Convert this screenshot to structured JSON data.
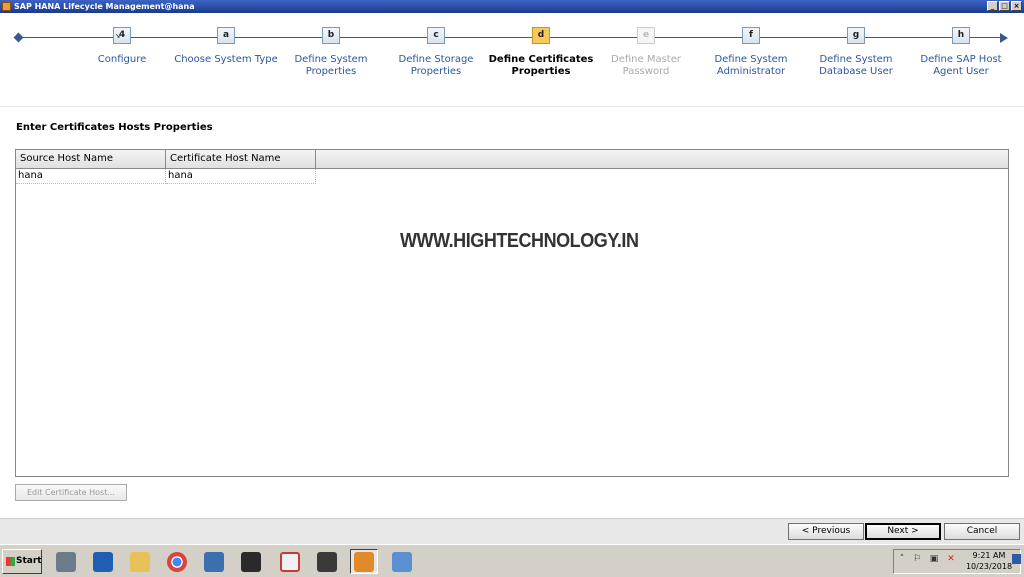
{
  "window": {
    "title": "SAP HANA Lifecycle Management@hana",
    "minimize": "_",
    "maximize": "□",
    "close": "×"
  },
  "roadmap": {
    "steps": [
      {
        "key": "4",
        "sub": "↘",
        "label_line1": "Configure",
        "label_line2": "",
        "state": "normal"
      },
      {
        "key": "a",
        "sub": "",
        "label_line1": "Choose System Type",
        "label_line2": "",
        "state": "normal"
      },
      {
        "key": "b",
        "sub": "",
        "label_line1": "Define System",
        "label_line2": "Properties",
        "state": "normal"
      },
      {
        "key": "c",
        "sub": "",
        "label_line1": "Define Storage",
        "label_line2": "Properties",
        "state": "normal"
      },
      {
        "key": "d",
        "sub": "",
        "label_line1": "Define Certificates",
        "label_line2": "Properties",
        "state": "active"
      },
      {
        "key": "e",
        "sub": "",
        "label_line1": "Define Master",
        "label_line2": "Password",
        "state": "disabled"
      },
      {
        "key": "f",
        "sub": "",
        "label_line1": "Define System",
        "label_line2": "Administrator",
        "state": "normal"
      },
      {
        "key": "g",
        "sub": "",
        "label_line1": "Define System",
        "label_line2": "Database User",
        "state": "normal"
      },
      {
        "key": "h",
        "sub": "",
        "label_line1": "Define SAP Host",
        "label_line2": "Agent User",
        "state": "normal"
      }
    ]
  },
  "content": {
    "section_title": "Enter Certificates Hosts Properties",
    "table": {
      "columns": [
        "Source Host Name",
        "Certificate Host Name"
      ],
      "rows": [
        [
          "hana",
          "hana"
        ]
      ]
    },
    "watermark": "WWW.HIGHTECHNOLOGY.IN",
    "edit_button": "Edit Certificate Host..."
  },
  "nav": {
    "previous": "< Previous",
    "next": "Next >",
    "cancel": "Cancel"
  },
  "taskbar": {
    "start": "Start",
    "apps": [
      {
        "name": "server-manager-icon",
        "color": "#6b7b8c"
      },
      {
        "name": "powershell-icon",
        "color": "#1f5fb3"
      },
      {
        "name": "file-explorer-icon",
        "color": "#e8c15a"
      },
      {
        "name": "chrome-icon",
        "color": "#db4437"
      },
      {
        "name": "network-tool-icon",
        "color": "#3b6fb0"
      },
      {
        "name": "hat-tool-icon",
        "color": "#2a2a2a"
      },
      {
        "name": "snipping-tool-icon",
        "color": "#c43b3b"
      },
      {
        "name": "terminal-icon",
        "color": "#3a3a3a"
      },
      {
        "name": "sap-hana-lifecycle-icon",
        "color": "#e08a2a"
      },
      {
        "name": "image-viewer-icon",
        "color": "#5a8fd0"
      }
    ],
    "clock_time": "9:21 AM",
    "clock_date": "10/23/2018"
  }
}
